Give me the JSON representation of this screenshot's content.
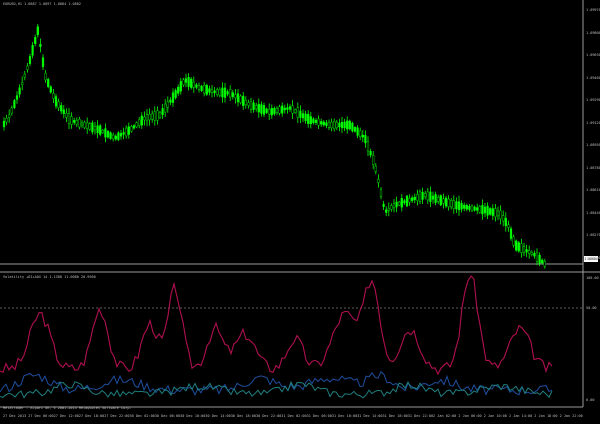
{
  "header": {
    "symbol_line": "EURUSD,H1  1.0887 1.0897 1.0884 1.0882"
  },
  "indicator": {
    "title": "Volatility +DI+ADX 14 1.1388 11.0080 20.9960",
    "level_label": "50.00"
  },
  "price_axis": {
    "ticks": [
      "1.09970",
      "1.09800",
      "1.09630",
      "1.09460",
      "1.09290",
      "1.09120",
      "1.08950",
      "1.08780",
      "1.08610",
      "1.08440",
      "1.08270",
      "1.08100"
    ],
    "current_price": "1.08004"
  },
  "indicator_axis": {
    "ticks": [
      "100.00",
      "50.00",
      "0.00"
    ]
  },
  "time_axis": {
    "labels": [
      "27 Dec 2013",
      "27 Dec 06:00",
      "27 Dec 12:00",
      "27 Dec 18:00",
      "27 Dec 22:00",
      "30 Dec 02:00",
      "30 Dec 06:00",
      "30 Dec 10:00",
      "30 Dec 14:00",
      "30 Dec 18:00",
      "30 Dec 22:00",
      "31 Dec 02:00",
      "31 Dec 06:00",
      "31 Dec 10:00",
      "31 Dec 14:00",
      "31 Dec 18:00",
      "31 Dec 22:00",
      "2 Jan 02:00",
      "2 Jan 06:00",
      "2 Jan 10:00",
      "2 Jan 14:00",
      "2 Jan 18:00",
      "2 Jan 22:00"
    ]
  },
  "footer": {
    "text": "MetaTrader - Alpari UK, © 2001-2013 MetaQuotes Software Corp."
  },
  "colors": {
    "bull": "#00ff00",
    "bear": "#00ff00",
    "adx": "#b01050",
    "plus_di": "#1f4f9f",
    "minus_di": "#1f7f7f",
    "grid": "#707070"
  }
}
